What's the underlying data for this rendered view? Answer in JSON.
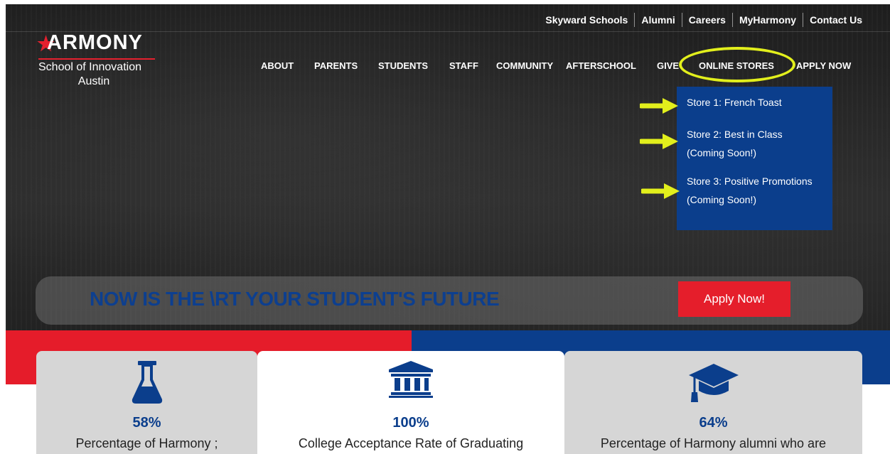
{
  "utility_nav": [
    "Skyward Schools",
    "Alumni",
    "Careers",
    "MyHarmony",
    "Contact Us"
  ],
  "logo": {
    "wordmark": "ARMONY",
    "subtitle": "School of Innovation",
    "city": "Austin"
  },
  "main_nav": [
    "ABOUT",
    "PARENTS",
    "STUDENTS",
    "STAFF",
    "COMMUNITY",
    "AFTERSCHOOL",
    "GIVE",
    "ONLINE STORES",
    "APPLY NOW"
  ],
  "dropdown": {
    "items": [
      "Store 1: French Toast",
      "Store 2: Best in Class (Coming Soon!)",
      "Store 3: Positive Promotions (Coming Soon!)"
    ]
  },
  "banner": {
    "headline": "NOW IS THE \\RT YOUR STUDENT'S FUTURE",
    "button": "Apply Now!"
  },
  "stats": [
    {
      "icon": "flask-icon",
      "value": "58%",
      "label": "Percentage of Harmony ;"
    },
    {
      "icon": "institution-icon",
      "value": "100%",
      "label": "College Acceptance Rate of Graduating"
    },
    {
      "icon": "graduation-cap-icon",
      "value": "64%",
      "label": "Percentage of Harmony alumni who are"
    }
  ],
  "colors": {
    "brand_blue": "#0b3e8c",
    "brand_red": "#e51c2a",
    "annotation_yellow": "#e2ef1c"
  }
}
